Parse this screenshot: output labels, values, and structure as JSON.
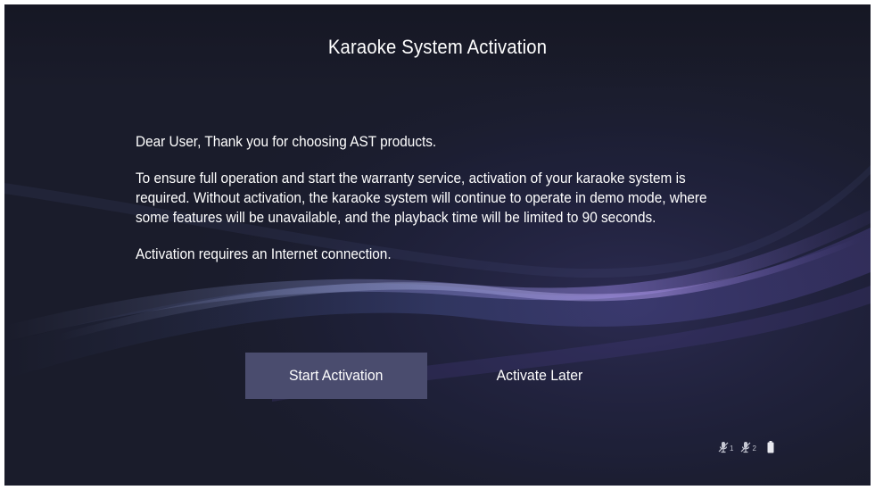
{
  "dialog": {
    "title": "Karaoke System Activation",
    "paragraphs": [
      "Dear User, Thank you for choosing AST products.",
      "To ensure full operation and start the warranty service, activation of your karaoke system is required. Without activation, the karaoke system will continue to operate in demo mode, where some features will be unavailable, and the playback time will be limited to 90 seconds.",
      "Activation requires an Internet connection."
    ]
  },
  "buttons": {
    "start_label": "Start Activation",
    "later_label": "Activate Later"
  },
  "status": {
    "mic1_number": "1",
    "mic2_number": "2",
    "mic1_icon": "microphone-off-icon",
    "mic2_icon": "microphone-off-icon",
    "battery_icon": "battery-icon"
  },
  "colors": {
    "background": "#1a1c2b",
    "button_selected": "#4a4c6e",
    "text": "#ffffff"
  }
}
